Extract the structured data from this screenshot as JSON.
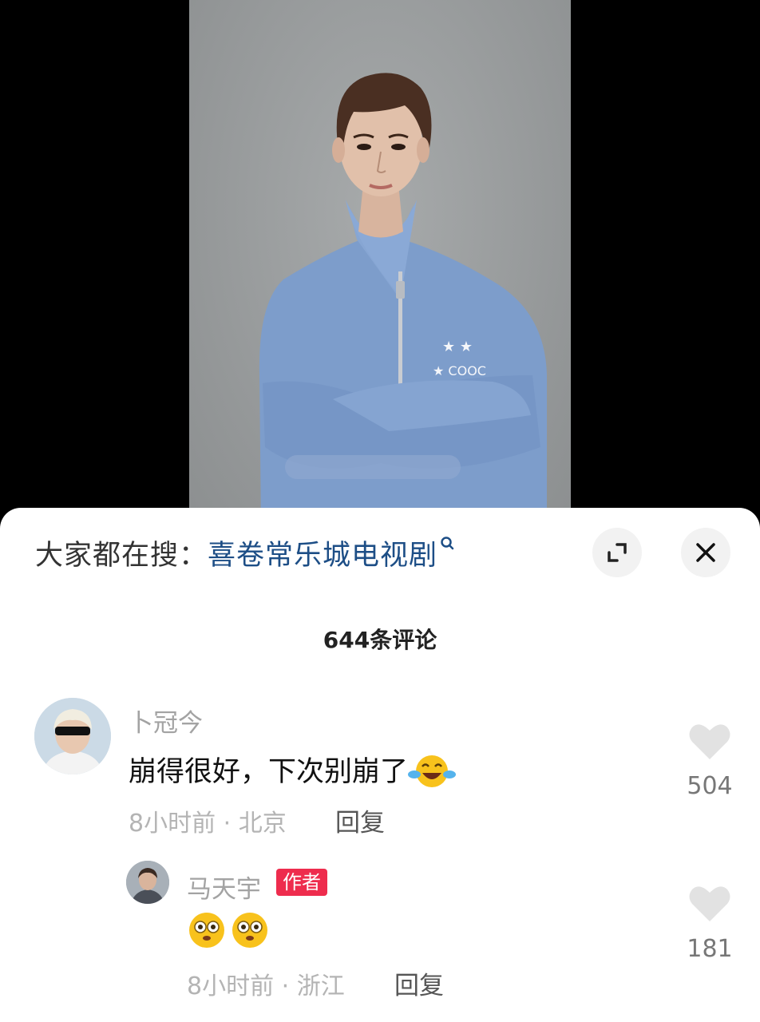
{
  "search_bar": {
    "prefix": "大家都在搜：",
    "term": "喜卷常乐城电视剧"
  },
  "comments_header": {
    "count_label": "644条评论"
  },
  "comments": [
    {
      "username": "卜冠今",
      "text": "崩得很好，下次别崩了",
      "emoji": "laughing-crying-emoji",
      "meta": "8小时前 · 北京",
      "reply_label": "回复",
      "likes": "504"
    }
  ],
  "replies": [
    {
      "username": "马天宇",
      "badge": "作者",
      "emojis": [
        "wide-eyed-emoji",
        "wide-eyed-emoji"
      ],
      "meta": "8小时前 · 浙江",
      "reply_label": "回复",
      "likes": "181"
    }
  ],
  "colors": {
    "search_term": "#1d4e86",
    "author_badge": "#ee2c4d",
    "heart": "#e2e2e2"
  }
}
